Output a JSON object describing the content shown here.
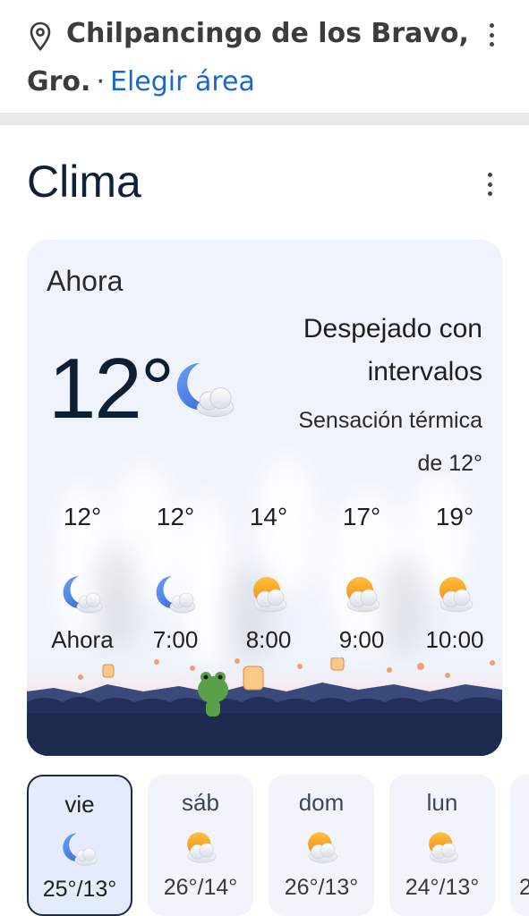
{
  "location": {
    "name_line1": "Chilpancingo de los Bravo,",
    "name_line2": "Gro.",
    "separator": "·",
    "change_area_link": "Elegir área"
  },
  "weather": {
    "title": "Clima",
    "now_label": "Ahora",
    "current_temp": "12°",
    "current_icon": "night-partly-cloudy-icon",
    "condition_line1": "Despejado con",
    "condition_line2": "intervalos",
    "feels_like_line1": "Sensación térmica",
    "feels_like_line2": "de 12°",
    "hourly": [
      {
        "temp": "12°",
        "label": "Ahora",
        "icon": "night-partly-cloudy-icon"
      },
      {
        "temp": "12°",
        "label": "7:00",
        "icon": "night-partly-cloudy-icon"
      },
      {
        "temp": "14°",
        "label": "8:00",
        "icon": "partly-sunny-icon"
      },
      {
        "temp": "17°",
        "label": "9:00",
        "icon": "partly-sunny-icon"
      },
      {
        "temp": "19°",
        "label": "10:00",
        "icon": "partly-sunny-icon"
      }
    ],
    "daily": [
      {
        "day": "vie",
        "temp": "25°/13°",
        "icon": "night-partly-cloudy-icon",
        "selected": true
      },
      {
        "day": "sáb",
        "temp": "26°/14°",
        "icon": "partly-sunny-icon",
        "selected": false
      },
      {
        "day": "dom",
        "temp": "26°/13°",
        "icon": "partly-sunny-icon",
        "selected": false
      },
      {
        "day": "lun",
        "temp": "24°/13°",
        "icon": "partly-sunny-icon",
        "selected": false
      }
    ],
    "daily_peek_text": "2"
  },
  "colors": {
    "link": "#1a66d2",
    "card_background": "#eef3fc",
    "moon": "#4a7fe0",
    "sun": "#f4a020"
  }
}
